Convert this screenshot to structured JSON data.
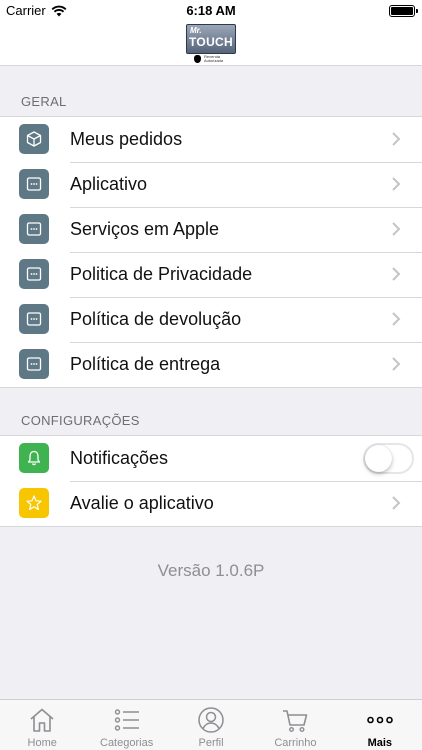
{
  "status_bar": {
    "carrier": "Carrier",
    "time": "6:18 AM"
  },
  "header": {
    "logo_text_small": "Mr.",
    "logo_text_main": "TOUCH",
    "logo_caption": "Revenda Autorizada"
  },
  "sections": [
    {
      "title": "GERAL",
      "items": [
        {
          "label": "Meus pedidos",
          "icon": "package-icon"
        },
        {
          "label": "Aplicativo",
          "icon": "document-icon"
        },
        {
          "label": "Serviços em Apple",
          "icon": "document-icon"
        },
        {
          "label": "Politica de Privacidade",
          "icon": "document-icon"
        },
        {
          "label": "Política de devolução",
          "icon": "document-icon"
        },
        {
          "label": "Política de entrega",
          "icon": "document-icon"
        }
      ]
    },
    {
      "title": "CONFIGURAÇÕES",
      "items": [
        {
          "label": "Notificações",
          "icon": "bell-icon",
          "toggle": false
        },
        {
          "label": "Avalie o aplicativo",
          "icon": "star-icon"
        }
      ]
    }
  ],
  "version": "Versão 1.0.6P",
  "tab_bar": {
    "tabs": [
      {
        "label": "Home",
        "icon": "home-icon",
        "active": false
      },
      {
        "label": "Categorias",
        "icon": "list-icon",
        "active": false
      },
      {
        "label": "Perfil",
        "icon": "user-icon",
        "active": false
      },
      {
        "label": "Carrinho",
        "icon": "cart-icon",
        "active": false
      },
      {
        "label": "Mais",
        "icon": "more-icon",
        "active": true
      }
    ]
  },
  "colors": {
    "icon_slate": "#5f7885",
    "icon_green": "#3fb34f",
    "icon_yellow": "#f7c600",
    "background": "#efeff4"
  }
}
